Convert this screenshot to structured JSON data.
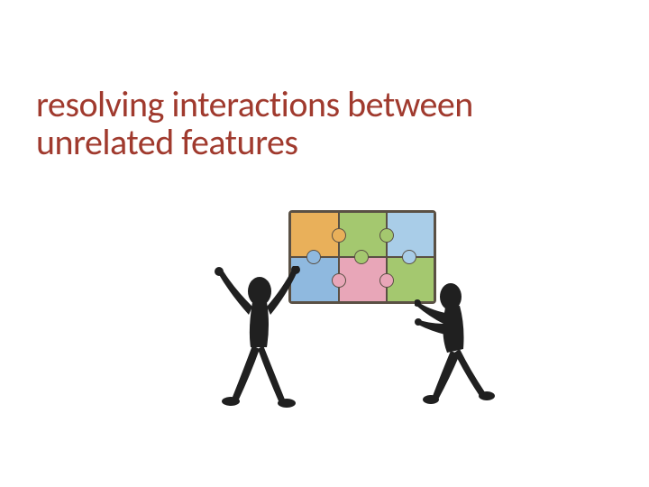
{
  "title": "resolving interactions between unrelated features",
  "illustration": {
    "piece_colors": [
      "#e9b05a",
      "#a4c86f",
      "#a9cde8",
      "#8fb9df",
      "#e8a6b8",
      "#a4c86f"
    ],
    "figure_color": "#202020",
    "left_figure": "stick-figure-arms-raised",
    "right_figure": "stick-figure-pushing"
  }
}
